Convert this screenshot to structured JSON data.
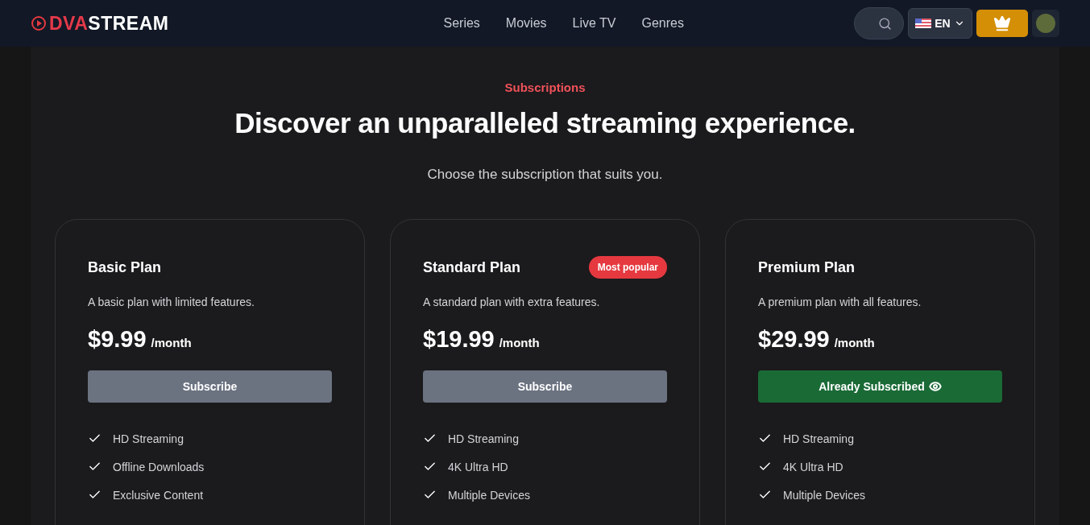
{
  "header": {
    "logo": {
      "first": "DVA",
      "second": "STREAM"
    },
    "nav": [
      {
        "label": "Series"
      },
      {
        "label": "Movies"
      },
      {
        "label": "Live TV"
      },
      {
        "label": "Genres"
      }
    ],
    "language": "EN"
  },
  "hero": {
    "eyebrow": "Subscriptions",
    "title": "Discover an unparalleled streaming experience.",
    "subtitle": "Choose the subscription that suits you."
  },
  "plans": [
    {
      "name": "Basic Plan",
      "description": "A basic plan with limited features.",
      "price": "$9.99",
      "period": "/month",
      "button": "Subscribe",
      "subscribed": false,
      "features": [
        "HD Streaming",
        "Offline Downloads",
        "Exclusive Content"
      ]
    },
    {
      "name": "Standard Plan",
      "badge": "Most popular",
      "description": "A standard plan with extra features.",
      "price": "$19.99",
      "period": "/month",
      "button": "Subscribe",
      "subscribed": false,
      "features": [
        "HD Streaming",
        "4K Ultra HD",
        "Multiple Devices"
      ]
    },
    {
      "name": "Premium Plan",
      "description": "A premium plan with all features.",
      "price": "$29.99",
      "period": "/month",
      "button": "Already Subscribed",
      "subscribed": true,
      "features": [
        "HD Streaming",
        "4K Ultra HD",
        "Multiple Devices"
      ]
    }
  ]
}
